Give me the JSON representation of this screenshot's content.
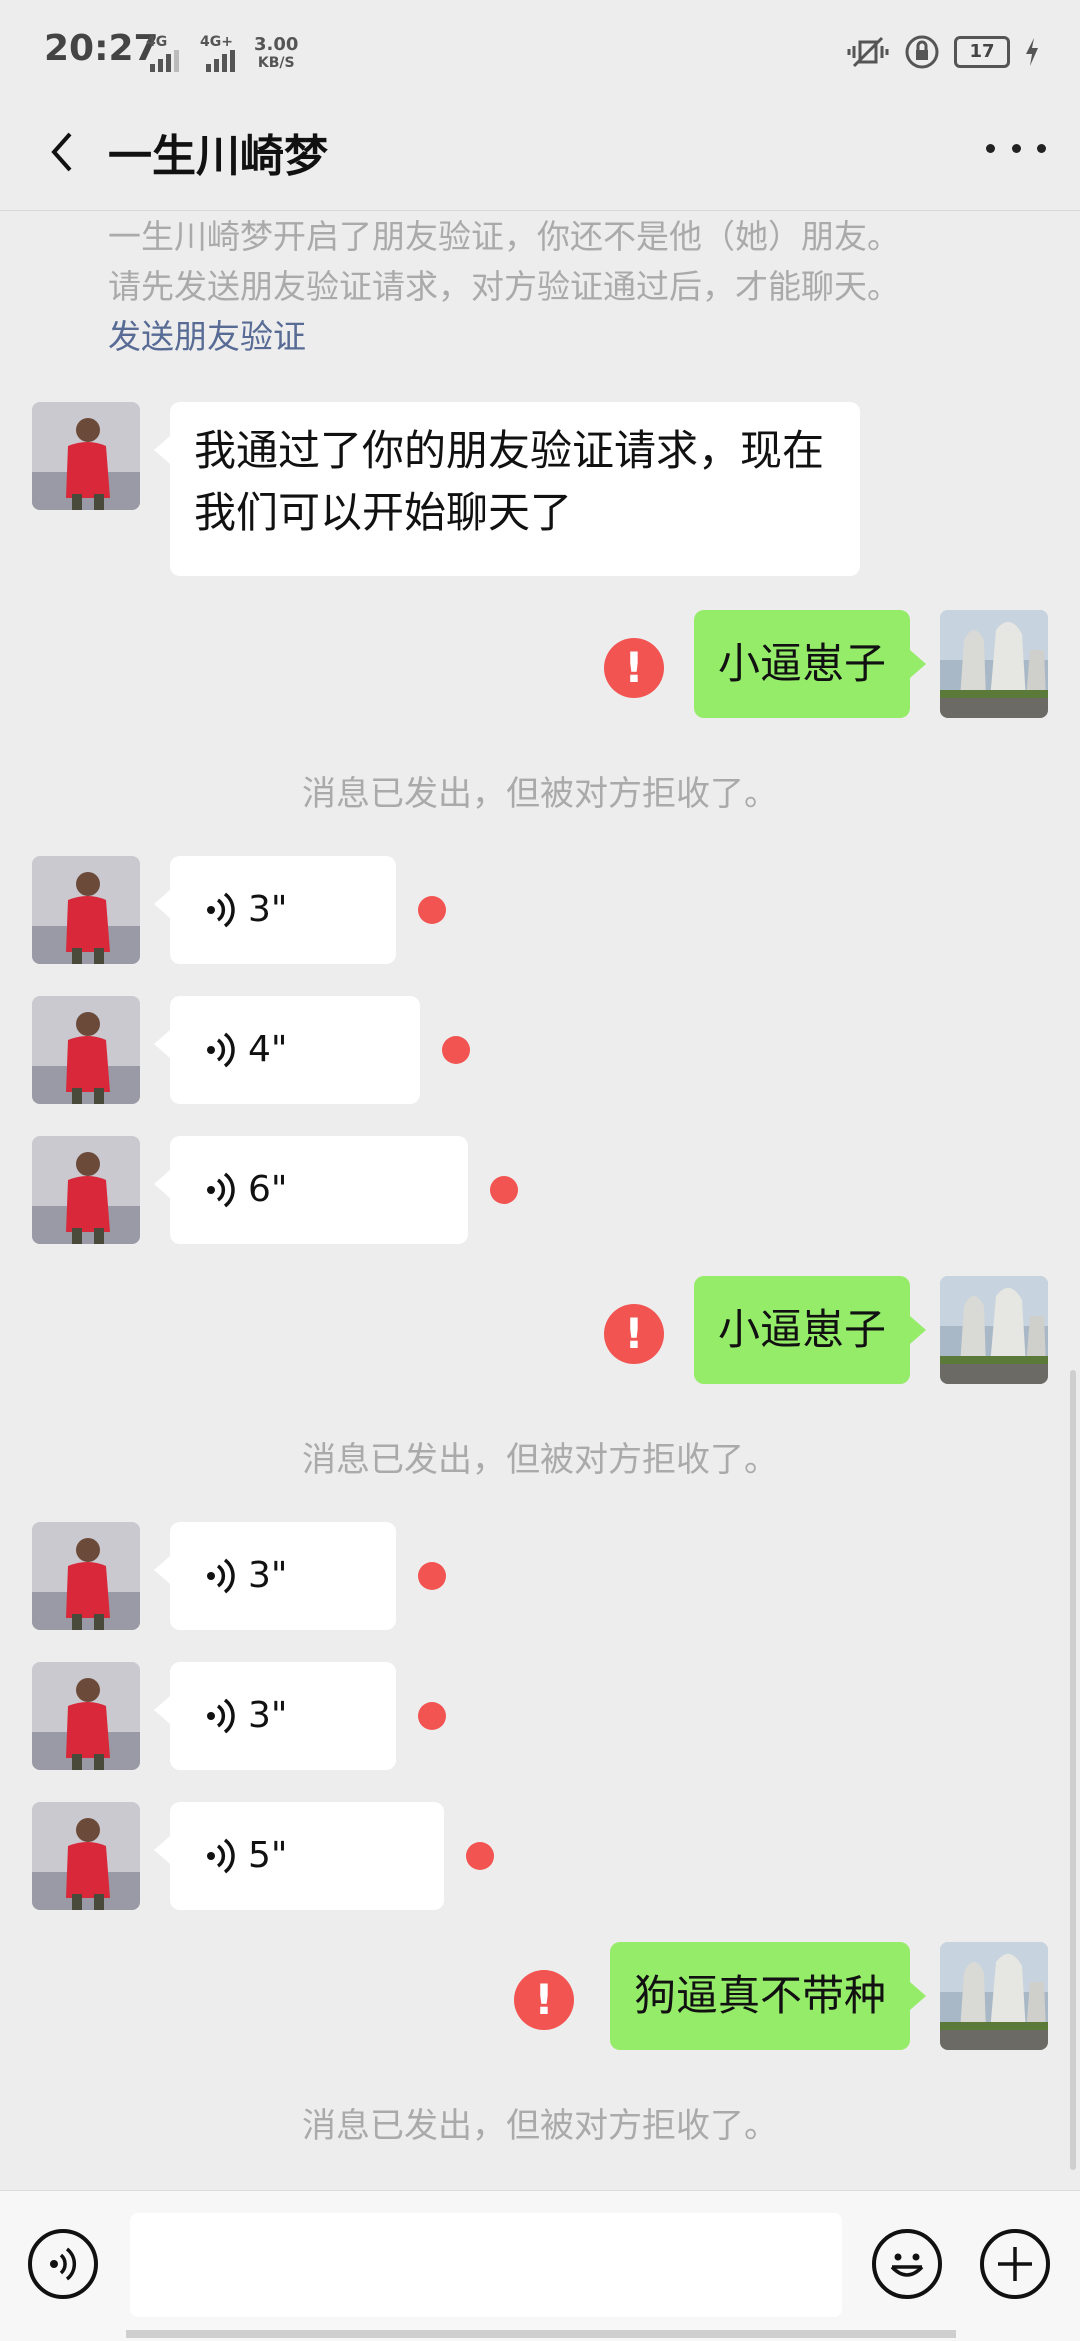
{
  "status_bar": {
    "time": "20:27",
    "net1": "4G",
    "net2": "4G+",
    "speed_value": "3.00",
    "speed_unit": "KB/S",
    "battery": "17"
  },
  "header": {
    "title": "一生川崎梦"
  },
  "notice": {
    "line1": "一生川崎梦开启了朋友验证，你还不是他（她）朋友。",
    "line2": "请先发送朋友验证请求，对方验证通过后，才能聊天。",
    "link": "发送朋友验证"
  },
  "messages": {
    "m1_line1": "我通过了你的朋友验证请求，现在",
    "m1_line2": "我们可以开始聊天了",
    "m2": "小逼崽子",
    "rejected": "消息已发出，但被对方拒收了。",
    "v1": "3\"",
    "v2": "4\"",
    "v3": "6\"",
    "m3": "小逼崽子",
    "v4": "3\"",
    "v5": "3\"",
    "v6": "5\"",
    "m4": "狗逼真不带种"
  },
  "icons": {
    "error": "!",
    "accent_green": "#95ec69",
    "error_red": "#f25452",
    "link_blue": "#576b95"
  }
}
